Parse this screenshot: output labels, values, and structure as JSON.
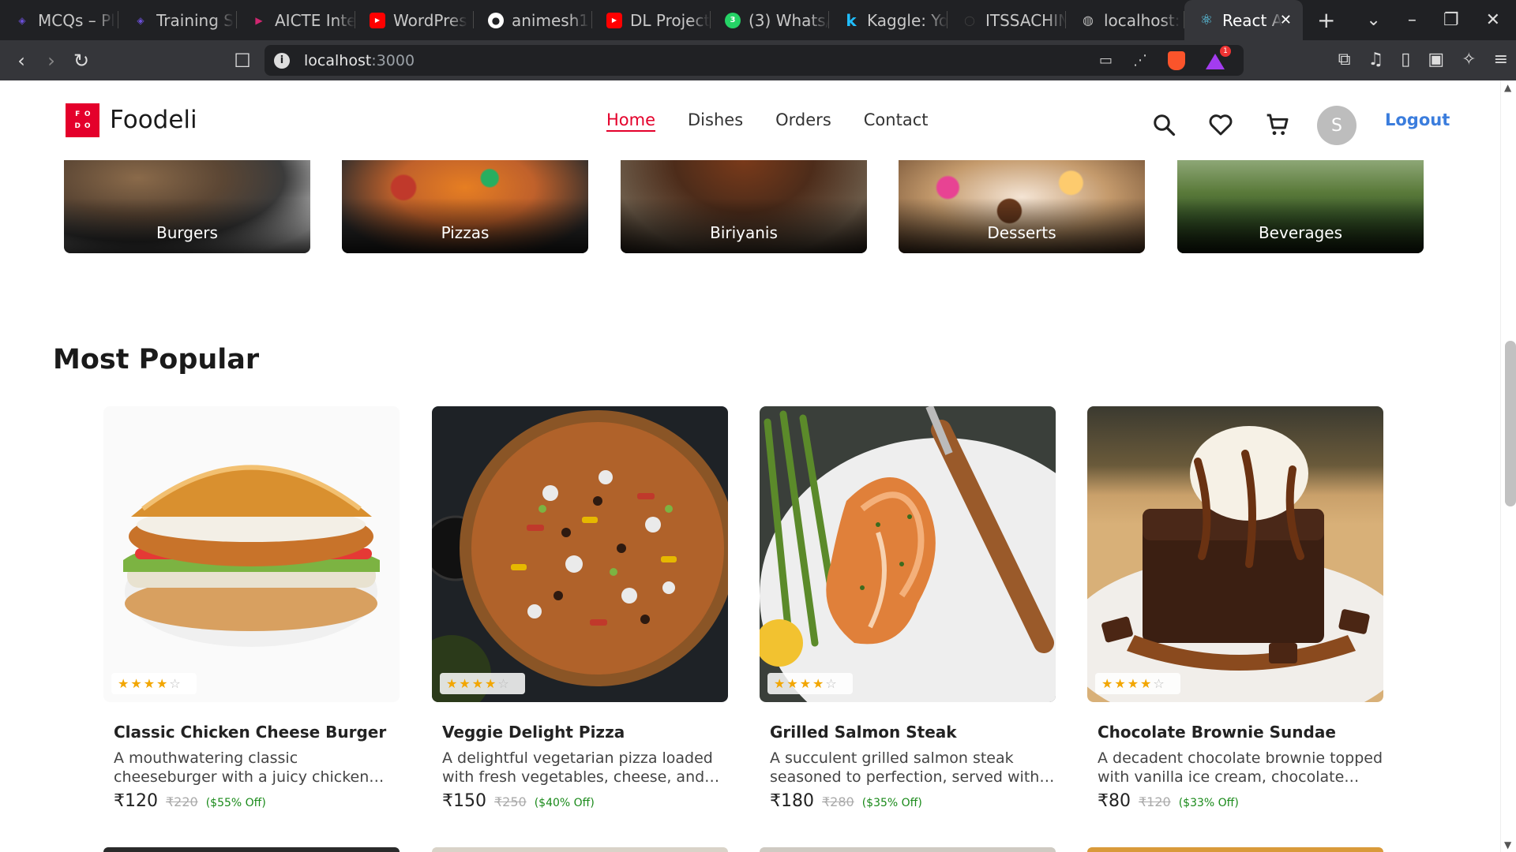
{
  "browser": {
    "tabs": [
      {
        "label": "MCQs – Pl",
        "icon": "layers-icon",
        "color": "#6b4fd8"
      },
      {
        "label": "Training S",
        "icon": "layers-icon",
        "color": "#6b4fd8"
      },
      {
        "label": "AICTE Inte",
        "icon": "play-icon",
        "color": "#d02670"
      },
      {
        "label": "WordPres",
        "icon": "youtube-icon",
        "color": "#ff0000"
      },
      {
        "label": "animesh1",
        "icon": "github-icon",
        "color": "#ffffff"
      },
      {
        "label": "DL Project",
        "icon": "youtube-icon",
        "color": "#ff0000"
      },
      {
        "label": "(3) Whats/",
        "icon": "whatsapp-icon",
        "color": "#25d366"
      },
      {
        "label": "Kaggle: Yo",
        "icon": "kaggle-icon",
        "color": "#20beff"
      },
      {
        "label": "ITSSACHIN",
        "icon": "globe-icon",
        "color": "#444444"
      },
      {
        "label": "localhost:",
        "icon": "globe-icon",
        "color": "#bbbbbb"
      }
    ],
    "active_tab": {
      "label": "React A",
      "icon": "react-icon",
      "color": "#61dafb"
    },
    "url_host": "localhost",
    "url_port": ":3000"
  },
  "site": {
    "logo_letters": [
      "F",
      "O",
      "D",
      "O"
    ],
    "brand": "Foodeli",
    "nav": [
      "Home",
      "Dishes",
      "Orders",
      "Contact"
    ],
    "avatar_initial": "S",
    "logout": "Logout",
    "accent": "#e4002b"
  },
  "categories": [
    "Burgers",
    "Pizzas",
    "Biriyanis",
    "Desserts",
    "Beverages"
  ],
  "section_title": "Most Popular",
  "products": [
    {
      "name": "Classic Chicken Cheese Burger",
      "desc": "A mouthwatering classic cheeseburger with a juicy chicken patty, melted…",
      "price": "₹120",
      "mrp": "₹220",
      "discount": "($55% Off)",
      "rating": 4
    },
    {
      "name": "Veggie Delight Pizza",
      "desc": "A delightful vegetarian pizza loaded with fresh vegetables, cheese, and o…",
      "price": "₹150",
      "mrp": "₹250",
      "discount": "($40% Off)",
      "rating": 4
    },
    {
      "name": "Grilled Salmon Steak",
      "desc": "A succulent grilled salmon steak seasoned to perfection, served with a…",
      "price": "₹180",
      "mrp": "₹280",
      "discount": "($35% Off)",
      "rating": 4
    },
    {
      "name": "Chocolate Brownie Sundae",
      "desc": "A decadent chocolate brownie topped with vanilla ice cream, chocolate sau…",
      "price": "₹80",
      "mrp": "₹120",
      "discount": "($33% Off)",
      "rating": 4
    }
  ]
}
